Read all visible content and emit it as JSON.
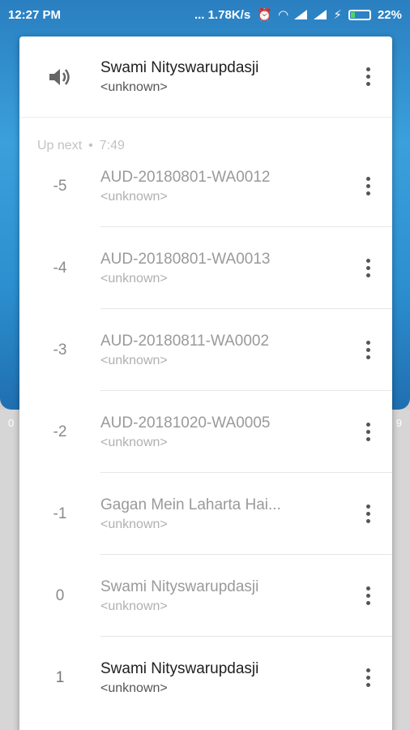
{
  "status_bar": {
    "time": "12:27 PM",
    "network_speed": "... 1.78K/s",
    "battery": "22%"
  },
  "background": {
    "time_left": "0",
    "time_right": "9"
  },
  "now_playing": {
    "title": "Swami Nityswarupdasji",
    "subtitle": "<unknown>",
    "icon": "volume-icon"
  },
  "up_next": {
    "label": "Up next",
    "separator": "•",
    "duration": "7:49"
  },
  "queue": [
    {
      "index": "-5",
      "title": "AUD-20180801-WA0012",
      "subtitle": "<unknown>"
    },
    {
      "index": "-4",
      "title": "AUD-20180801-WA0013",
      "subtitle": "<unknown>"
    },
    {
      "index": "-3",
      "title": "AUD-20180811-WA0002",
      "subtitle": "<unknown>"
    },
    {
      "index": "-2",
      "title": "AUD-20181020-WA0005",
      "subtitle": "<unknown>"
    },
    {
      "index": "-1",
      "title": "Gagan Mein Laharta Hai...",
      "subtitle": "<unknown>"
    },
    {
      "index": "0",
      "title": "Swami Nityswarupdasji",
      "subtitle": "<unknown>"
    },
    {
      "index": "1",
      "title": "Swami Nityswarupdasji",
      "subtitle": "<unknown>"
    }
  ],
  "colors": {
    "accent": "#2a8fd0",
    "battery_fill": "#4cd964"
  }
}
